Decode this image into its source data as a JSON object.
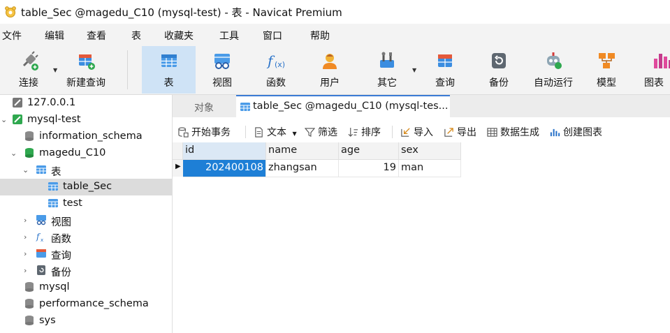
{
  "window": {
    "title": "table_Sec @magedu_C10 (mysql-test) - 表 - Navicat Premium"
  },
  "menu": [
    "文件",
    "编辑",
    "查看",
    "表",
    "收藏夹",
    "工具",
    "窗口",
    "帮助"
  ],
  "toolbar": {
    "connect": "连接",
    "new_query": "新建查询",
    "table": "表",
    "view": "视图",
    "function": "函数",
    "user": "用户",
    "other": "其它",
    "query": "查询",
    "backup": "备份",
    "automation": "自动运行",
    "model": "模型",
    "chart": "图表"
  },
  "tree": {
    "conn1": "127.0.0.1",
    "conn2": "mysql-test",
    "db_information_schema": "information_schema",
    "db_magedu": "magedu_C10",
    "folder_tables": "表",
    "table_sec": "table_Sec",
    "table_test": "test",
    "folder_views": "视图",
    "folder_functions": "函数",
    "folder_queries": "查询",
    "folder_backups": "备份",
    "db_mysql": "mysql",
    "db_perf": "performance_schema",
    "db_sys": "sys"
  },
  "tabs": {
    "objects": "对象",
    "active": "table_Sec @magedu_C10 (mysql-tes..."
  },
  "actions": {
    "begin_tx": "开始事务",
    "text": "文本",
    "filter": "筛选",
    "sort": "排序",
    "import": "导入",
    "export": "导出",
    "generate": "数据生成",
    "create_chart": "创建图表"
  },
  "grid": {
    "columns": [
      "id",
      "name",
      "age",
      "sex"
    ],
    "rows": [
      {
        "id": "202400108",
        "name": "zhangsan",
        "age": "19",
        "sex": "man"
      }
    ]
  }
}
